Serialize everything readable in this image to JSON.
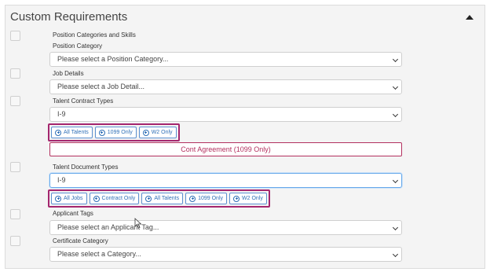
{
  "panel": {
    "title": "Custom Requirements"
  },
  "sections": {
    "position_categories_and_skills": "Position Categories and Skills",
    "position_category": {
      "label": "Position Category",
      "value": "Please select a Position Category..."
    },
    "job_details": {
      "label": "Job Details",
      "value": "Please select a Job Detail..."
    },
    "talent_contract_types": {
      "label": "Talent Contract Types",
      "value": "I-9",
      "buttons": [
        "All Talents",
        "1099 Only",
        "W2 Only"
      ],
      "agreement": "Cont Agreement (1099 Only)"
    },
    "talent_document_types": {
      "label": "Talent Document Types",
      "value": "I-9",
      "buttons": [
        "All Jobs",
        "Contract Only",
        "All Talents",
        "1099 Only",
        "W2 Only"
      ]
    },
    "applicant_tags": {
      "label": "Applicant Tags",
      "value": "Please select an Applicant Tag..."
    },
    "certificate_category": {
      "label": "Certificate Category",
      "value": "Please select a Category..."
    }
  },
  "colors": {
    "highlight_border": "#a4266e",
    "link_blue": "#2f6fb7",
    "agreement_red": "#b3305f"
  },
  "icons": {
    "collapse": "chevron-up-icon",
    "add": "plus-circle-icon",
    "select": "chevron-down-icon",
    "cursor": "mouse-pointer-icon"
  }
}
